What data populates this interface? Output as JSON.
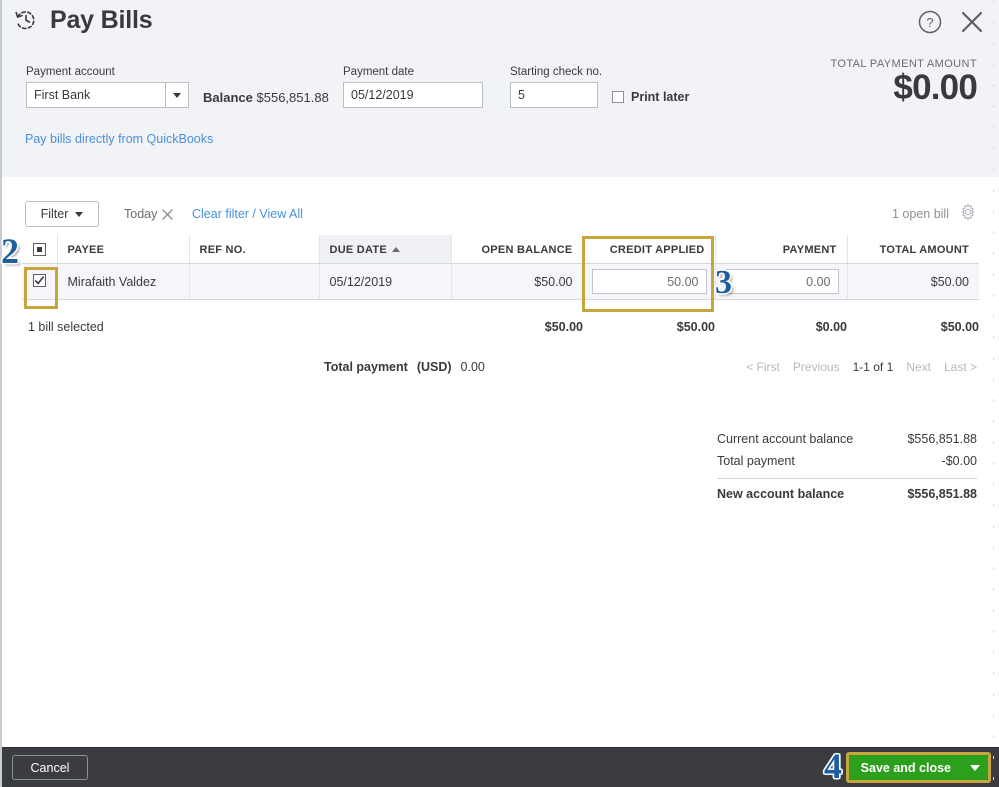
{
  "header": {
    "title": "Pay Bills",
    "history_icon": "clock-history-icon",
    "help_icon": "help-circle-icon",
    "close_icon": "close-x-icon",
    "payment_account_label": "Payment account",
    "payment_account_value": "First Bank",
    "balance_prefix": "Balance",
    "balance_value": "$556,851.88",
    "payment_date_label": "Payment date",
    "payment_date_value": "05/12/2019",
    "check_no_label": "Starting check no.",
    "check_no_value": "5",
    "print_later_label": "Print later",
    "print_later_checked": false,
    "total_payment_amount_label": "TOTAL PAYMENT AMOUNT",
    "total_payment_amount_value": "$0.00",
    "qb_link": "Pay bills directly from QuickBooks"
  },
  "toolbar": {
    "filter_label": "Filter",
    "chip_label": "Today",
    "chip_close_icon": "close-x-icon",
    "clear_filter_label": "Clear filter / View All",
    "open_bill_count": "1 open bill",
    "gear_icon": "gear-icon"
  },
  "table": {
    "columns": [
      "PAYEE",
      "REF NO.",
      "DUE DATE",
      "OPEN BALANCE",
      "CREDIT APPLIED",
      "PAYMENT",
      "TOTAL AMOUNT"
    ],
    "sorted_column": "DUE DATE",
    "sort_direction": "asc",
    "row": {
      "selected": true,
      "payee": "Mirafaith Valdez",
      "ref_no": "",
      "due_date": "05/12/2019",
      "open_balance": "$50.00",
      "credit_applied": "50.00",
      "payment": "0.00",
      "total_amount": "$50.00"
    },
    "totals": {
      "open_balance": "$50.00",
      "credit_applied": "$50.00",
      "payment": "$0.00",
      "total_amount": "$50.00"
    },
    "selection_note": "1 bill selected"
  },
  "total_payment": {
    "label": "Total payment",
    "currency": "(USD)",
    "value": "0.00"
  },
  "pager": {
    "first": "< First",
    "previous": "Previous",
    "current": "1-1 of 1",
    "next": "Next",
    "last": "Last >"
  },
  "summary": {
    "current_balance_label": "Current account balance",
    "current_balance_value": "$556,851.88",
    "total_payment_label": "Total payment",
    "total_payment_value": "-$0.00",
    "new_balance_label": "New account balance",
    "new_balance_value": "$556,851.88"
  },
  "footer": {
    "cancel_label": "Cancel",
    "save_label": "Save and close",
    "save_caret_icon": "chevron-down-icon"
  },
  "annotations": {
    "step_2": "2",
    "step_3": "3",
    "step_4": "4",
    "highlight_color": "#c7a53f",
    "number_color": "#1d5f9e"
  }
}
